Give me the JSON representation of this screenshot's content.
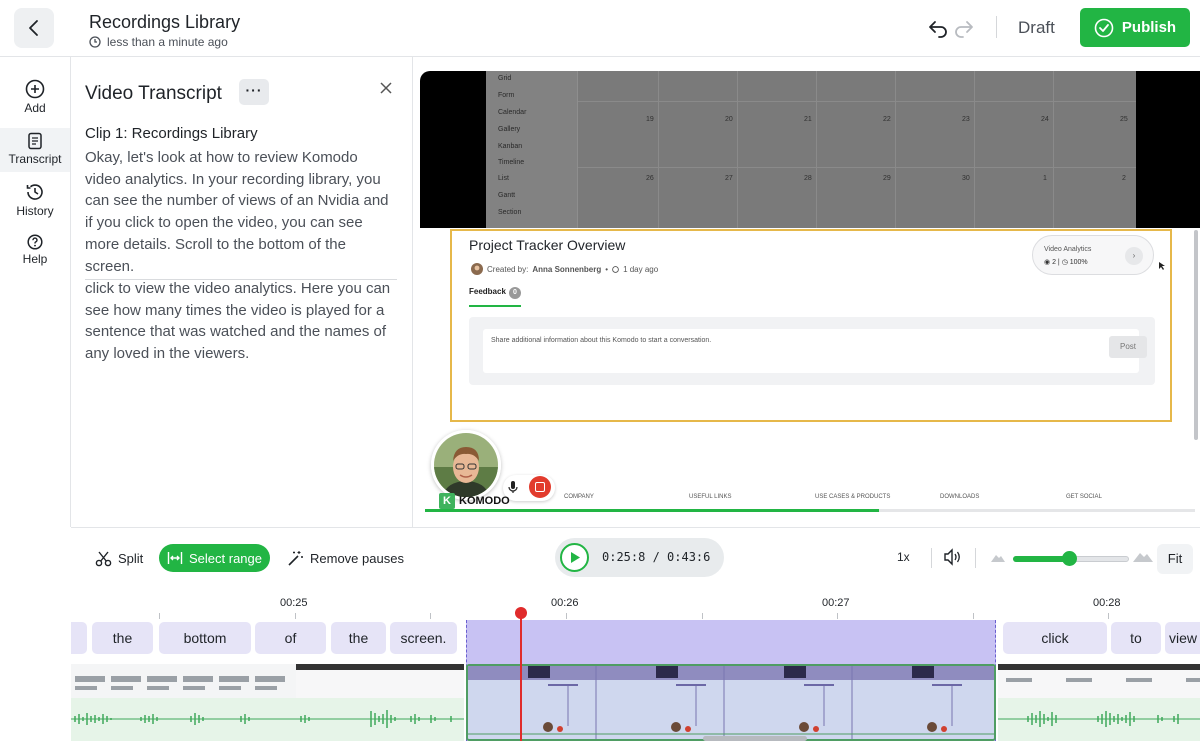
{
  "header": {
    "title": "Recordings Library",
    "subtitle": "less than a minute ago",
    "draft_label": "Draft",
    "publish_label": "Publish",
    "accent": "#22b544"
  },
  "nav": {
    "items": [
      {
        "label": "Add",
        "icon": "plus-circle-icon"
      },
      {
        "label": "Transcript",
        "icon": "document-icon"
      },
      {
        "label": "History",
        "icon": "clock-history-icon"
      },
      {
        "label": "Help",
        "icon": "question-circle-icon"
      }
    ]
  },
  "transcript": {
    "title": "Video Transcript",
    "more_label": "···",
    "clip_title": "Clip 1: Recordings Library",
    "paragraph_1": "Okay, let's look at how to review Komodo video analytics. In your recording library, you can see the number of views of an Nvidia and if you click to open the video, you can see more details. Scroll to the bottom of the screen.",
    "paragraph_2": "click to view the video analytics. Here you can see how many times the video is played for a sentence that was watched and the names of any loved in the viewers."
  },
  "preview": {
    "sidebar_items": [
      "Grid",
      "Form",
      "Calendar",
      "Gallery",
      "Kanban",
      "Timeline",
      "List",
      "Gantt",
      "Section"
    ],
    "calendar_row1": [
      "19",
      "20",
      "21",
      "22",
      "23",
      "24",
      "25"
    ],
    "calendar_row2": [
      "26",
      "27",
      "28",
      "29",
      "30",
      "1",
      "2"
    ],
    "card_title": "Project Tracker Overview",
    "created_by_label": "Created by:",
    "created_by": "Anna Sonnenberg",
    "created_time": "1 day ago",
    "feedback_label": "Feedback",
    "feedback_count": "0",
    "analytics_title": "Video Analytics",
    "analytics_views": "2",
    "analytics_completion": "100%",
    "comment_placeholder": "Share additional information about this Komodo to start a conversation.",
    "post_label": "Post",
    "footer_links": [
      "COMPANY",
      "USEFUL LINKS",
      "USE CASES & PRODUCTS",
      "DOWNLOADS",
      "GET SOCIAL"
    ],
    "brand": "KOMODO",
    "progress": 0.59
  },
  "toolbar": {
    "split_label": "Split",
    "select_range_label": "Select range",
    "remove_pauses_label": "Remove pauses",
    "timecode": "0:25:8 / 0:43:6",
    "speed": "1x",
    "fit_label": "Fit",
    "zoom_level": 0.48
  },
  "timeline": {
    "ticks": [
      "00:25",
      "00:26",
      "00:27",
      "00:28"
    ],
    "words_before": [
      "the",
      "bottom",
      "of",
      "the",
      "screen."
    ],
    "words_after": [
      "click",
      "to",
      "view"
    ]
  }
}
